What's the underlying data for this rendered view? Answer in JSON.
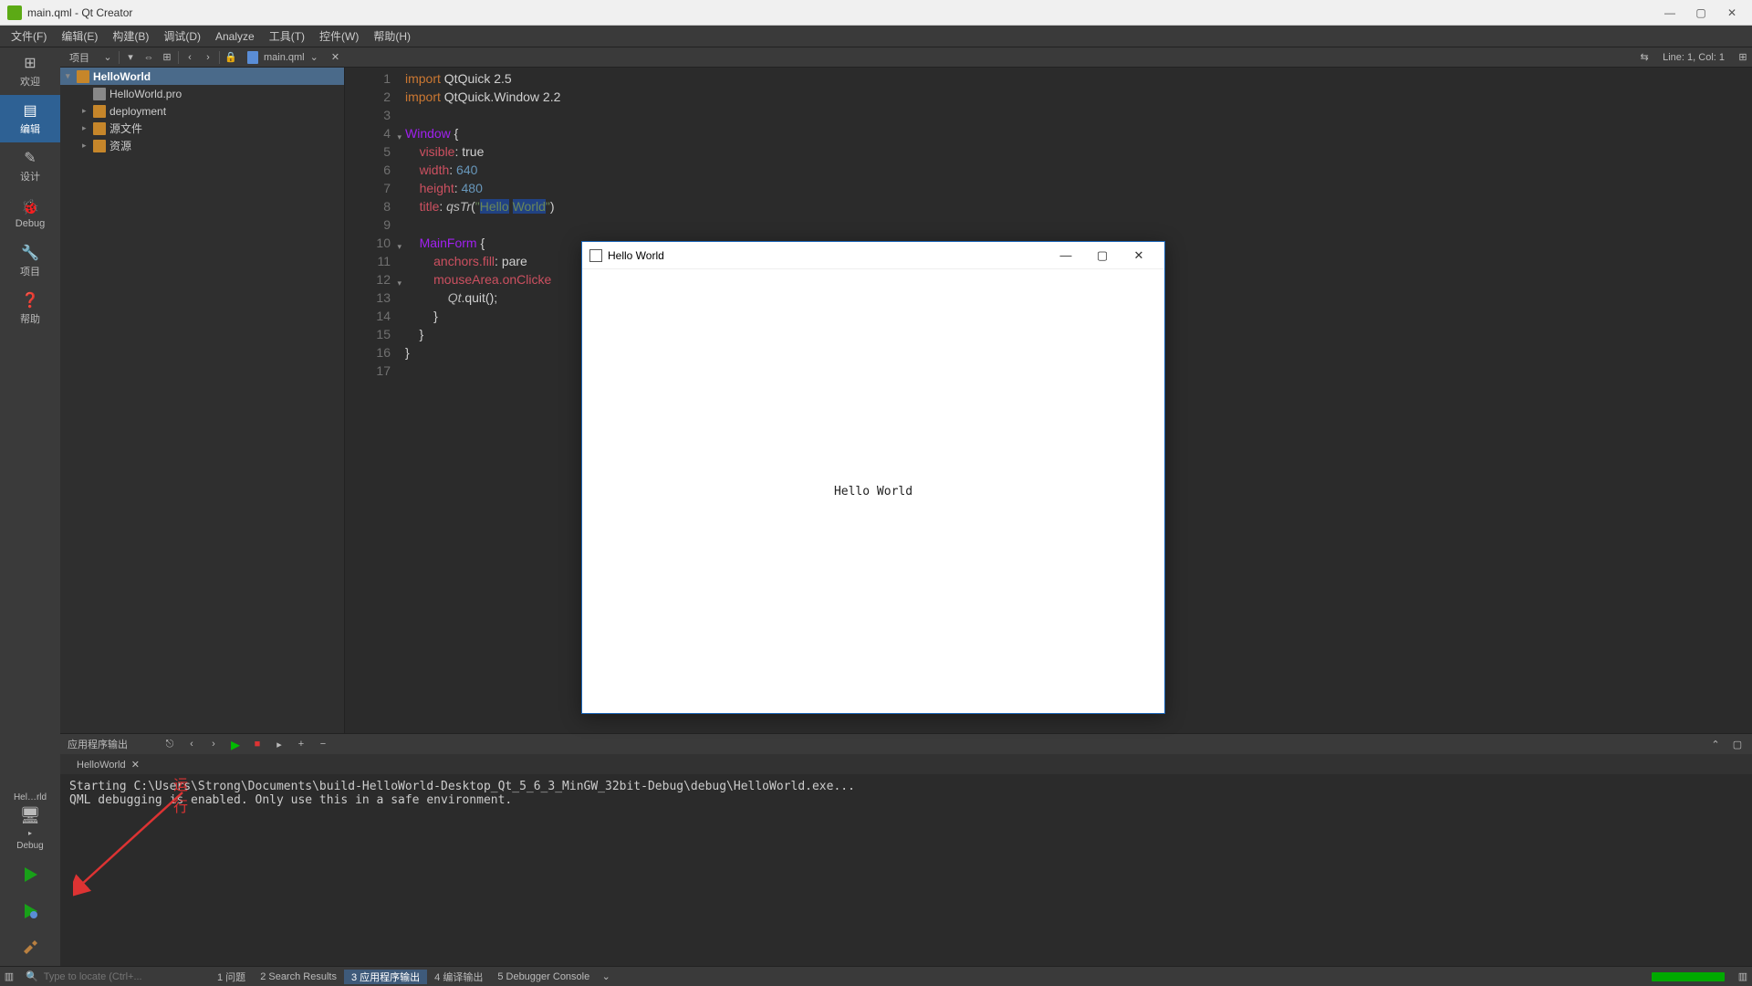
{
  "window": {
    "title": "main.qml - Qt Creator"
  },
  "menu": {
    "items": [
      "文件(F)",
      "编辑(E)",
      "构建(B)",
      "调试(D)",
      "Analyze",
      "工具(T)",
      "控件(W)",
      "帮助(H)"
    ]
  },
  "modebar": {
    "items": [
      {
        "label": "欢迎",
        "icon": "⊞"
      },
      {
        "label": "编辑",
        "icon": "▤",
        "active": true
      },
      {
        "label": "设计",
        "icon": "✎"
      },
      {
        "label": "Debug",
        "icon": "🐞"
      },
      {
        "label": "项目",
        "icon": "🔧"
      },
      {
        "label": "帮助",
        "icon": "❓"
      }
    ],
    "target_name": "Hel…rld",
    "target_mode": "Debug"
  },
  "toolrow": {
    "project_label": "项目",
    "open_file": "main.qml",
    "position": "Line: 1, Col: 1"
  },
  "project_tree": {
    "root": "HelloWorld",
    "children": [
      {
        "label": "HelloWorld.pro",
        "type": "file"
      },
      {
        "label": "deployment",
        "type": "folder"
      },
      {
        "label": "源文件",
        "type": "folder"
      },
      {
        "label": "资源",
        "type": "folder"
      }
    ]
  },
  "code": {
    "lines": [
      {
        "n": 1,
        "html": "<span class='kw'>import</span> QtQuick 2.5"
      },
      {
        "n": 2,
        "html": "<span class='kw'>import</span> QtQuick.Window 2.2"
      },
      {
        "n": 3,
        "html": ""
      },
      {
        "n": 4,
        "html": "<span class='type'>Window</span> {",
        "fold": true
      },
      {
        "n": 5,
        "html": "    <span class='prop'>visible</span>: true"
      },
      {
        "n": 6,
        "html": "    <span class='prop'>width</span>: <span class='num'>640</span>"
      },
      {
        "n": 7,
        "html": "    <span class='prop'>height</span>: <span class='num'>480</span>"
      },
      {
        "n": 8,
        "html": "    <span class='prop'>title</span>: <span class='func'>qsTr</span>(<span class='str'>\"<span class='str-hl'>Hello</span> <span class='str-hl'>World</span>\"</span>)"
      },
      {
        "n": 9,
        "html": ""
      },
      {
        "n": 10,
        "html": "    <span class='type'>MainForm</span> {",
        "fold": true
      },
      {
        "n": 11,
        "html": "        <span class='prop'>anchors.fill</span>: pare"
      },
      {
        "n": 12,
        "html": "        <span class='prop'>mouseArea.onClicke",
        "fold": true
      },
      {
        "n": 13,
        "html": "            <span class='func'>Qt</span>.quit();"
      },
      {
        "n": 14,
        "html": "        }"
      },
      {
        "n": 15,
        "html": "    }"
      },
      {
        "n": 16,
        "html": "}"
      },
      {
        "n": 17,
        "html": ""
      }
    ]
  },
  "output": {
    "title": "应用程序输出",
    "tab": "HelloWorld",
    "lines": [
      "Starting C:\\Users\\Strong\\Documents\\build-HelloWorld-Desktop_Qt_5_6_3_MinGW_32bit-Debug\\debug\\HelloWorld.exe...",
      "QML debugging is enabled. Only use this in a safe environment."
    ]
  },
  "statusbar": {
    "locator_placeholder": "Type to locate (Ctrl+...",
    "items": [
      {
        "label": "1 问题"
      },
      {
        "label": "2 Search Results"
      },
      {
        "label": "3 应用程序输出",
        "active": true
      },
      {
        "label": "4 编译输出"
      },
      {
        "label": "5 Debugger Console"
      }
    ]
  },
  "popup": {
    "title": "Hello World",
    "body": "Hello World"
  },
  "annotation": {
    "text": "运行"
  }
}
